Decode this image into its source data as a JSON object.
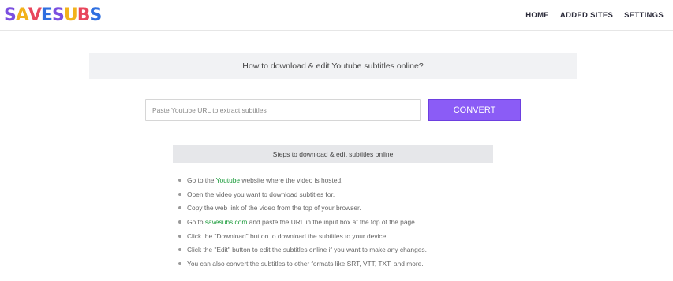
{
  "header": {
    "logo_text": "SAVESUBS",
    "nav": [
      "HOME",
      "ADDED SITES",
      "SETTINGS"
    ]
  },
  "banner": {
    "title": "How to download & edit Youtube subtitles online?"
  },
  "form": {
    "url_placeholder": "Paste Youtube URL to extract subtitles",
    "convert_label": "CONVERT"
  },
  "steps": {
    "title": "Steps to download & edit subtitles online",
    "items": [
      {
        "pre": "Go to the ",
        "link": "Youtube",
        "post": " website where the video is hosted."
      },
      {
        "pre": "Open the video you want to download subtitles for.",
        "link": "",
        "post": ""
      },
      {
        "pre": "Copy the web link of the video from the top of your browser.",
        "link": "",
        "post": ""
      },
      {
        "pre": "Go to ",
        "link": "savesubs.com",
        "post": " and paste the URL in the input box at the top of the page."
      },
      {
        "pre": "Click the \"Download\" button to download the subtitles to your device.",
        "link": "",
        "post": ""
      },
      {
        "pre": "Click the \"Edit\" button to edit the subtitles online if you want to make any changes.",
        "link": "",
        "post": ""
      },
      {
        "pre": "You can also convert the subtitles to other formats like SRT, VTT, TXT, and more.",
        "link": "",
        "post": ""
      }
    ]
  },
  "colors": {
    "accent": "#8b5cf6",
    "link": "#1a9b3a"
  }
}
